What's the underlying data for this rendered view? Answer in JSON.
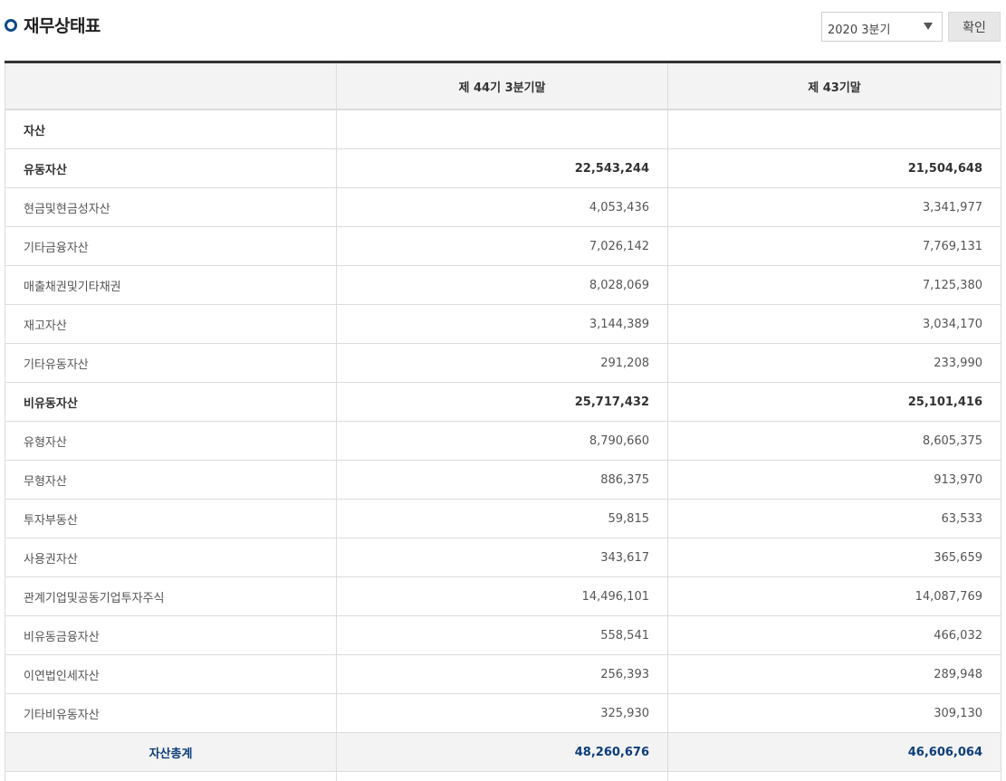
{
  "header": {
    "title": "재무상태표",
    "period_select": {
      "value": "2020 3분기"
    },
    "confirm_label": "확인"
  },
  "table": {
    "columns": [
      "",
      "제 44기 3분기말",
      "제 43기말"
    ],
    "rows": [
      {
        "label": "자산",
        "current": "",
        "previous": "",
        "bold": true
      },
      {
        "label": "유동자산",
        "current": "22,543,244",
        "previous": "21,504,648",
        "bold": true
      },
      {
        "label": "현금및현금성자산",
        "current": "4,053,436",
        "previous": "3,341,977"
      },
      {
        "label": "기타금융자산",
        "current": "7,026,142",
        "previous": "7,769,131"
      },
      {
        "label": "매출채권및기타채권",
        "current": "8,028,069",
        "previous": "7,125,380"
      },
      {
        "label": "재고자산",
        "current": "3,144,389",
        "previous": "3,034,170"
      },
      {
        "label": "기타유동자산",
        "current": "291,208",
        "previous": "233,990"
      },
      {
        "label": "비유동자산",
        "current": "25,717,432",
        "previous": "25,101,416",
        "bold": true
      },
      {
        "label": "유형자산",
        "current": "8,790,660",
        "previous": "8,605,375"
      },
      {
        "label": "무형자산",
        "current": "886,375",
        "previous": "913,970"
      },
      {
        "label": "투자부동산",
        "current": "59,815",
        "previous": "63,533"
      },
      {
        "label": "사용권자산",
        "current": "343,617",
        "previous": "365,659"
      },
      {
        "label": "관계기업및공동기업투자주식",
        "current": "14,496,101",
        "previous": "14,087,769"
      },
      {
        "label": "비유동금융자산",
        "current": "558,541",
        "previous": "466,032"
      },
      {
        "label": "이연법인세자산",
        "current": "256,393",
        "previous": "289,948"
      },
      {
        "label": "기타비유동자산",
        "current": "325,930",
        "previous": "309,130"
      },
      {
        "label": "자산총계",
        "current": "48,260,676",
        "previous": "46,606,064",
        "total": true
      }
    ]
  }
}
